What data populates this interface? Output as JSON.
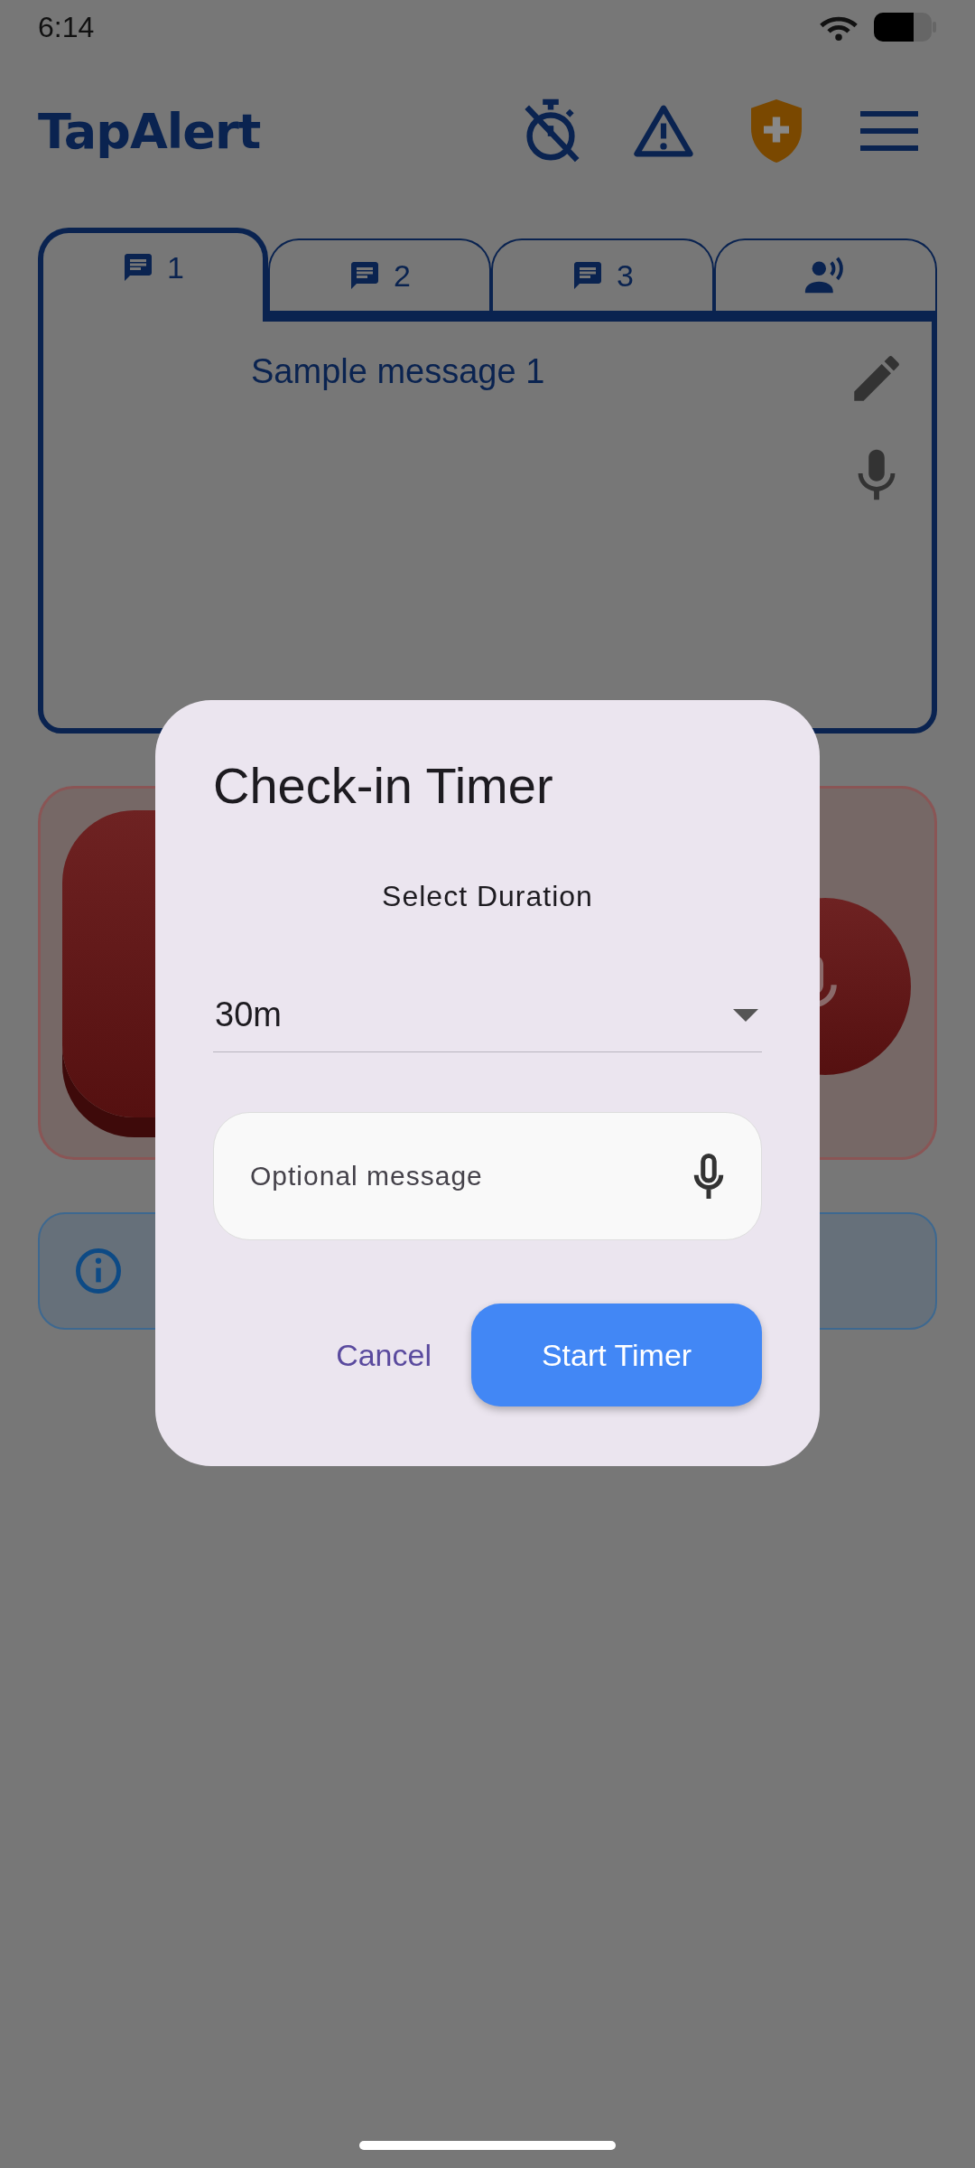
{
  "status_bar": {
    "time": "6:14"
  },
  "header": {
    "logo": "TapAlert"
  },
  "tabs": [
    {
      "kind": "message",
      "label": "1",
      "selected": true
    },
    {
      "kind": "message",
      "label": "2",
      "selected": false
    },
    {
      "kind": "message",
      "label": "3",
      "selected": false
    },
    {
      "kind": "voice",
      "selected": false
    }
  ],
  "message_card": {
    "text": "Sample message 1"
  },
  "dialog": {
    "title": "Check-in Timer",
    "subtitle": "Select Duration",
    "duration": {
      "value": "30m"
    },
    "message_field": {
      "placeholder": "Optional message"
    },
    "buttons": [
      {
        "kind": "text",
        "label": "Cancel"
      },
      {
        "kind": "filled",
        "label": "Start Timer"
      }
    ]
  }
}
